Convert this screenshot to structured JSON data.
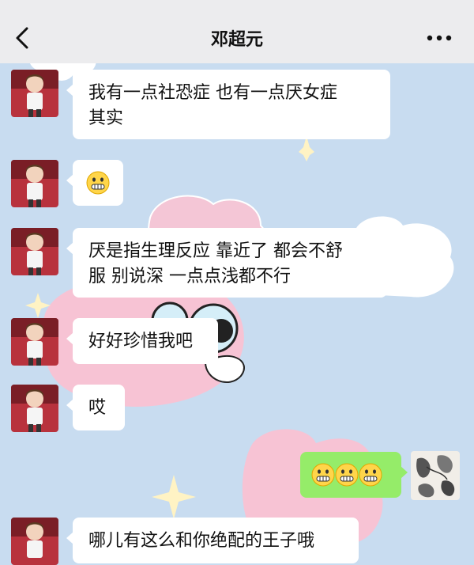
{
  "header": {
    "title": "邓超元",
    "back_icon": "chevron-left-icon",
    "more_icon": "more-dots-icon"
  },
  "messages": [
    {
      "side": "left",
      "text_lines": [
        "我有一点社恐症 也有一点厌女症",
        "其实"
      ]
    },
    {
      "side": "left",
      "emoji": "grimace-emoji",
      "count": 1
    },
    {
      "side": "left",
      "text_lines": [
        "厌是指生理反应 靠近了 都会不舒",
        "服 别说深 一点点浅都不行"
      ]
    },
    {
      "side": "left",
      "text_lines": [
        "好好珍惜我吧"
      ]
    },
    {
      "side": "left",
      "text_lines": [
        "哎"
      ]
    },
    {
      "side": "right",
      "emoji": "grimace-emoji",
      "count": 3
    },
    {
      "side": "left",
      "text_lines": [
        "哪儿有这么和你绝配的王子哦"
      ]
    }
  ],
  "colors": {
    "background": "#c8dcf0",
    "header": "#ececee",
    "bubble_left": "#ffffff",
    "bubble_right": "#95ec69"
  }
}
